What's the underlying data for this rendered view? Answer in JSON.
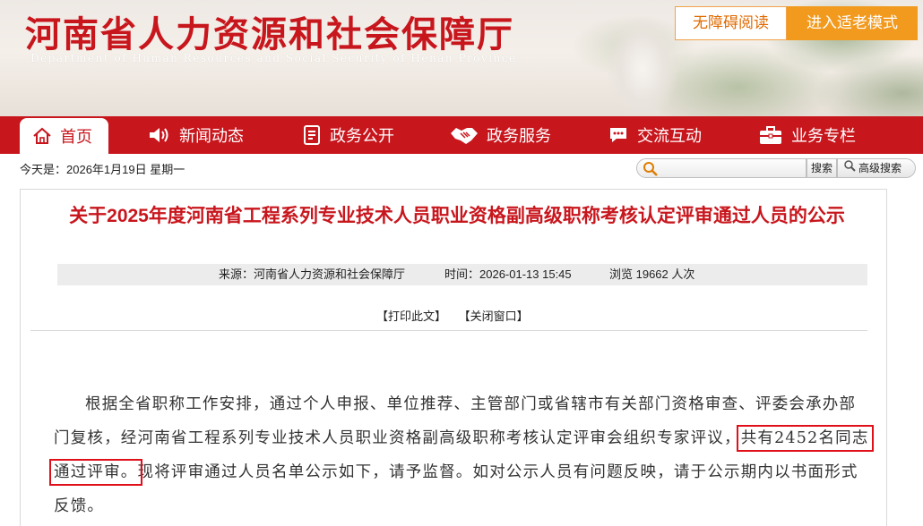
{
  "header": {
    "title": "河南省人力资源和社会保障厅",
    "subtitle": "Department of Human Resources and Social Security of Henan Province",
    "accessibility_label": "无障碍阅读",
    "elderly_mode_label": "进入适老模式"
  },
  "nav": {
    "items": [
      {
        "label": "首页",
        "icon": "home-icon"
      },
      {
        "label": "新闻动态",
        "icon": "speaker-icon"
      },
      {
        "label": "政务公开",
        "icon": "document-icon"
      },
      {
        "label": "政务服务",
        "icon": "handshake-icon"
      },
      {
        "label": "交流互动",
        "icon": "chat-icon"
      },
      {
        "label": "业务专栏",
        "icon": "briefcase-icon"
      }
    ],
    "active_color": "#c8161d"
  },
  "toolbar": {
    "today": "今天是：2026年1月19日 星期一",
    "search_label": "搜索",
    "advanced_search_label": "高级搜索"
  },
  "article": {
    "title": "关于2025年度河南省工程系列专业技术人员职业资格副高级职称考核认定评审通过人员的公示",
    "source": "来源：河南省人力资源和社会保障厅",
    "time": "时间：2026-01-13 15:45",
    "views": "浏览 19662 人次",
    "print_label": "【打印此文】",
    "close_label": "【关闭窗口】",
    "para_before": "根据全省职称工作安排，通过个人申报、单位推荐、主管部门或省辖市有关部门资格审查、评委会承办部门复核，经河南省工程系列专业技术人员职业资格副高级职称考核认定评审会组织专家评议，",
    "para_highlight": "共有2452名同志通过评审。",
    "para_after": "现将评审通过人员名单公示如下，请予监督。如对公示人员有问题反映，请于公示期内以书面形式反馈。"
  }
}
